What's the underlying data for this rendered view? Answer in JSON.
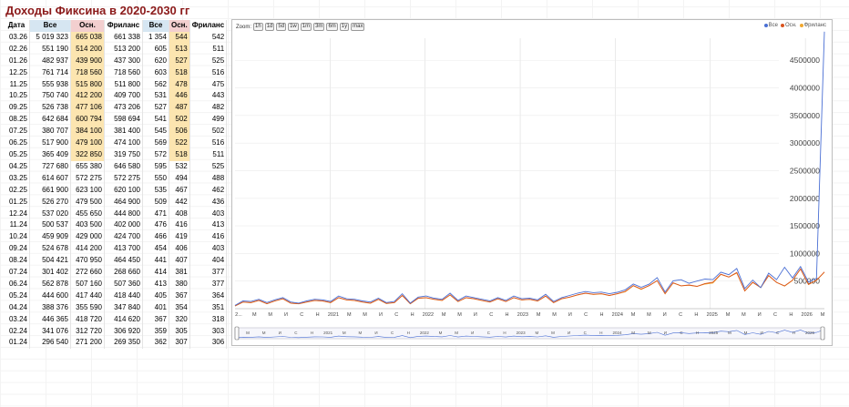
{
  "title": "Доходы Фиксина в 2020-2030 гг",
  "table": {
    "headers": [
      "Дата",
      "Все",
      "Осн.",
      "Фриланс",
      "Все",
      "Осн.",
      "Фриланс"
    ],
    "rows": [
      [
        "03.26",
        "5 019 323",
        "665 038",
        "661 338",
        "1 354",
        "544",
        "542"
      ],
      [
        "02.26",
        "551 190",
        "514 200",
        "513 200",
        "605",
        "513",
        "511"
      ],
      [
        "01.26",
        "482 937",
        "439 900",
        "437 300",
        "620",
        "527",
        "525"
      ],
      [
        "12.25",
        "761 714",
        "718 560",
        "718 560",
        "603",
        "518",
        "516"
      ],
      [
        "11.25",
        "555 938",
        "515 800",
        "511 800",
        "562",
        "478",
        "475"
      ],
      [
        "10.25",
        "750 740",
        "412 200",
        "409 700",
        "531",
        "446",
        "443"
      ],
      [
        "09.25",
        "526 738",
        "477 106",
        "473 206",
        "527",
        "487",
        "482"
      ],
      [
        "08.25",
        "642 684",
        "600 794",
        "598 694",
        "541",
        "502",
        "499"
      ],
      [
        "07.25",
        "380 707",
        "384 100",
        "381 400",
        "545",
        "506",
        "502"
      ],
      [
        "06.25",
        "517 900",
        "479 100",
        "474 100",
        "569",
        "522",
        "516"
      ],
      [
        "05.25",
        "365 409",
        "322 850",
        "319 750",
        "572",
        "518",
        "511"
      ],
      [
        "04.25",
        "727 680",
        "655 380",
        "646 580",
        "595",
        "532",
        "525"
      ],
      [
        "03.25",
        "614 607",
        "572 275",
        "572 275",
        "550",
        "494",
        "488"
      ],
      [
        "02.25",
        "661 900",
        "623 100",
        "620 100",
        "535",
        "467",
        "462"
      ],
      [
        "01.25",
        "526 270",
        "479 500",
        "464 900",
        "509",
        "442",
        "436"
      ],
      [
        "12.24",
        "537 020",
        "455 650",
        "444 800",
        "471",
        "408",
        "403"
      ],
      [
        "11.24",
        "500 537",
        "403 500",
        "402 000",
        "476",
        "416",
        "413"
      ],
      [
        "10.24",
        "459 909",
        "429 000",
        "424 700",
        "466",
        "419",
        "416"
      ],
      [
        "09.24",
        "524 678",
        "414 200",
        "413 700",
        "454",
        "406",
        "403"
      ],
      [
        "08.24",
        "504 421",
        "470 950",
        "464 450",
        "441",
        "407",
        "404"
      ],
      [
        "07.24",
        "301 402",
        "272 660",
        "268 660",
        "414",
        "381",
        "377"
      ],
      [
        "06.24",
        "562 878",
        "507 160",
        "507 360",
        "413",
        "380",
        "377"
      ],
      [
        "05.24",
        "444 600",
        "417 440",
        "418 440",
        "405",
        "367",
        "364"
      ],
      [
        "04.24",
        "388 376",
        "355 590",
        "347 840",
        "401",
        "354",
        "351"
      ],
      [
        "03.24",
        "446 365",
        "418 720",
        "414 620",
        "367",
        "320",
        "318"
      ],
      [
        "02.24",
        "341 076",
        "312 720",
        "306 920",
        "359",
        "305",
        "303"
      ],
      [
        "01.24",
        "296 540",
        "271 200",
        "269 350",
        "362",
        "307",
        "306"
      ]
    ],
    "highlight_cols": [
      2,
      5
    ],
    "highlight_rows": 11
  },
  "chart": {
    "zoom_label": "Zoom:",
    "zoom_buttons": [
      "1h",
      "1d",
      "5d",
      "1w",
      "1m",
      "3m",
      "6m",
      "1y",
      "max"
    ],
    "legend": [
      {
        "name": "Все",
        "color": "#4a6fd4"
      },
      {
        "name": "Осн.",
        "color": "#d9541e"
      },
      {
        "name": "Фриланс",
        "color": "#f0a830"
      }
    ],
    "y_ticks": [
      "4500000",
      "4000000",
      "3500000",
      "3000000",
      "2500000",
      "2000000",
      "1500000",
      "1000000",
      "500000"
    ],
    "x_labels": [
      "2...",
      "М",
      "М",
      "И",
      "С",
      "Н",
      "2021",
      "М",
      "М",
      "И",
      "С",
      "Н",
      "2022",
      "М",
      "М",
      "И",
      "С",
      "Н",
      "2023",
      "М",
      "М",
      "И",
      "С",
      "Н",
      "2024",
      "М",
      "М",
      "И",
      "С",
      "Н",
      "2025",
      "М",
      "М",
      "И",
      "С",
      "Н",
      "2026",
      "М"
    ],
    "nav_labels": [
      "М",
      "М",
      "И",
      "С",
      "Н",
      "2021",
      "М",
      "М",
      "И",
      "С",
      "Н",
      "2022",
      "М",
      "М",
      "И",
      "С",
      "Н",
      "2023",
      "М",
      "М",
      "И",
      "С",
      "Н",
      "2024",
      "М",
      "М",
      "И",
      "С",
      "Н",
      "2025",
      "М",
      "М",
      "И",
      "С",
      "Н",
      "2026"
    ]
  },
  "chart_data": {
    "type": "line",
    "ylim": [
      0,
      4900000
    ],
    "y_ticks": [
      500000,
      1000000,
      1500000,
      2000000,
      2500000,
      3000000,
      3500000,
      4000000,
      4500000
    ],
    "x": [
      "2020-01",
      "2020-02",
      "2020-03",
      "2020-04",
      "2020-05",
      "2020-06",
      "2020-07",
      "2020-08",
      "2020-09",
      "2020-10",
      "2020-11",
      "2020-12",
      "2021-01",
      "2021-02",
      "2021-03",
      "2021-04",
      "2021-05",
      "2021-06",
      "2021-07",
      "2021-08",
      "2021-09",
      "2021-10",
      "2021-11",
      "2021-12",
      "2022-01",
      "2022-02",
      "2022-03",
      "2022-04",
      "2022-05",
      "2022-06",
      "2022-07",
      "2022-08",
      "2022-09",
      "2022-10",
      "2022-11",
      "2022-12",
      "2023-01",
      "2023-02",
      "2023-03",
      "2023-04",
      "2023-05",
      "2023-06",
      "2023-07",
      "2023-08",
      "2023-09",
      "2023-10",
      "2023-11",
      "2023-12",
      "2024-01",
      "2024-02",
      "2024-03",
      "2024-04",
      "2024-05",
      "2024-06",
      "2024-07",
      "2024-08",
      "2024-09",
      "2024-10",
      "2024-11",
      "2024-12",
      "2025-01",
      "2025-02",
      "2025-03",
      "2025-04",
      "2025-05",
      "2025-06",
      "2025-07",
      "2025-08",
      "2025-09",
      "2025-10",
      "2025-11",
      "2025-12",
      "2026-01",
      "2026-02",
      "2026-03"
    ],
    "series": [
      {
        "name": "Все",
        "values": [
          60000,
          140000,
          130000,
          170000,
          110000,
          160000,
          200000,
          120000,
          100000,
          140000,
          170000,
          160000,
          130000,
          230000,
          180000,
          170000,
          140000,
          120000,
          190000,
          110000,
          130000,
          270000,
          100000,
          210000,
          230000,
          190000,
          170000,
          280000,
          150000,
          230000,
          200000,
          170000,
          140000,
          200000,
          150000,
          230000,
          180000,
          190000,
          160000,
          260000,
          130000,
          200000,
          240000,
          280000,
          310000,
          290000,
          300000,
          270000,
          296540,
          341076,
          446365,
          388376,
          444600,
          562878,
          301402,
          504421,
          524678,
          459909,
          500537,
          537020,
          526270,
          661900,
          614607,
          727680,
          365409,
          517900,
          380707,
          642684,
          526738,
          750740,
          555938,
          761714,
          482937,
          551190,
          5019323
        ]
      },
      {
        "name": "Осн.",
        "values": [
          50000,
          120000,
          110000,
          150000,
          90000,
          140000,
          180000,
          100000,
          90000,
          120000,
          150000,
          140000,
          110000,
          200000,
          160000,
          150000,
          120000,
          100000,
          170000,
          95000,
          110000,
          240000,
          90000,
          190000,
          200000,
          170000,
          150000,
          250000,
          130000,
          200000,
          180000,
          150000,
          120000,
          180000,
          130000,
          200000,
          160000,
          170000,
          140000,
          230000,
          110000,
          180000,
          210000,
          250000,
          280000,
          260000,
          270000,
          240000,
          271200,
          312720,
          418720,
          355590,
          417440,
          507160,
          272660,
          470950,
          414200,
          429000,
          403500,
          455650,
          479500,
          623100,
          572275,
          655380,
          322850,
          479100,
          384100,
          600794,
          477106,
          412200,
          515800,
          718560,
          439900,
          514200,
          665038
        ]
      },
      {
        "name": "Фриланс",
        "values": [
          48000,
          118000,
          108000,
          148000,
          88000,
          138000,
          178000,
          98000,
          88000,
          118000,
          148000,
          138000,
          108000,
          198000,
          158000,
          148000,
          118000,
          98000,
          168000,
          93000,
          108000,
          238000,
          88000,
          188000,
          198000,
          168000,
          148000,
          248000,
          128000,
          198000,
          178000,
          148000,
          118000,
          178000,
          128000,
          198000,
          158000,
          168000,
          138000,
          228000,
          108000,
          178000,
          208000,
          248000,
          278000,
          258000,
          268000,
          238000,
          269350,
          306920,
          414620,
          347840,
          418440,
          507360,
          268660,
          464450,
          413700,
          424700,
          402000,
          444800,
          464900,
          620100,
          572275,
          646580,
          319750,
          474100,
          381400,
          598694,
          473206,
          409700,
          511800,
          718560,
          437300,
          513200,
          661338
        ]
      }
    ]
  }
}
